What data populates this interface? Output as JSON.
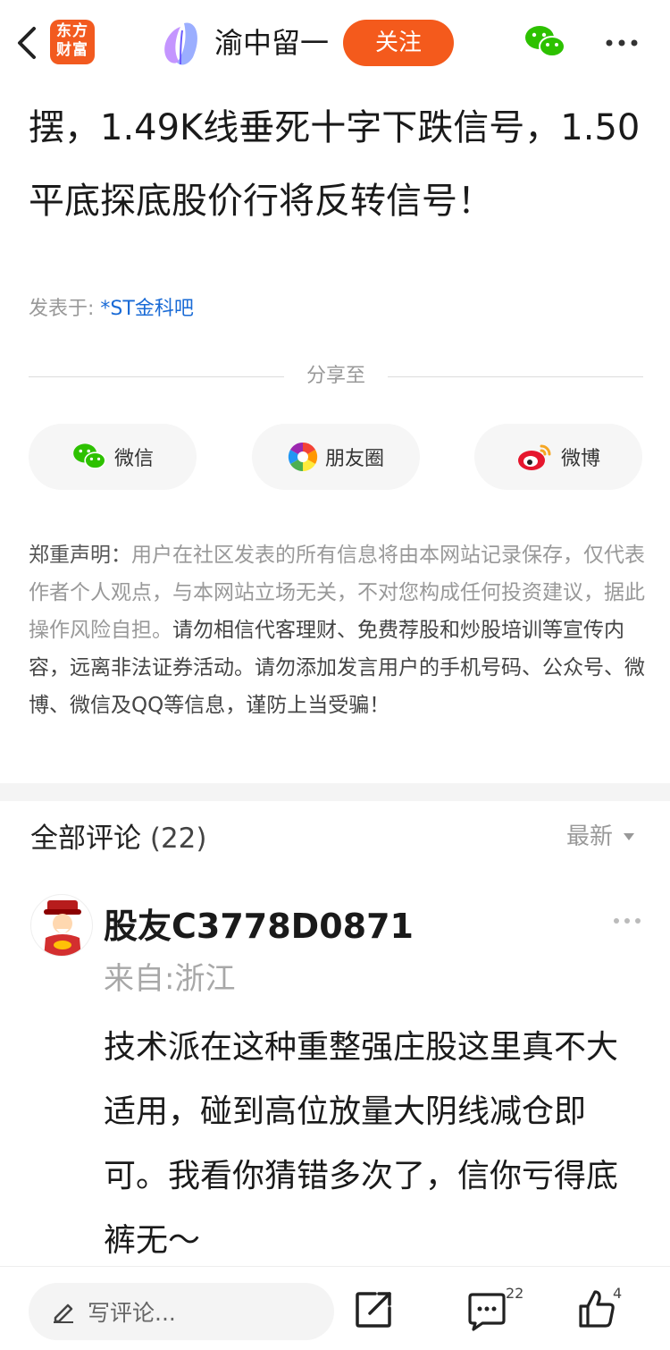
{
  "header": {
    "app_logo_line1": "东方",
    "app_logo_line2": "财富",
    "author_name": "渝中留一",
    "follow_label": "关注"
  },
  "post": {
    "title": "摆，1.49K线垂死十字下跌信号，1.50平底探底股价行将反转信号！",
    "posted_in_label": "发表于:",
    "bar_name": "*ST金科吧"
  },
  "share": {
    "label": "分享至",
    "wechat": "微信",
    "moments": "朋友圈",
    "weibo": "微博"
  },
  "disclaimer": {
    "label": "郑重声明：",
    "text_light": "用户在社区发表的所有信息将由本网站记录保存，仅代表作者个人观点，与本网站立场无关，不对您构成任何投资建议，据此操作风险自担。",
    "text_dark": "请勿相信代客理财、免费荐股和炒股培训等宣传内容，远离非法证券活动。请勿添加发言用户的手机号码、公众号、微博、微信及QQ等信息，谨防上当受骗！"
  },
  "comments": {
    "title": "全部评论",
    "count": "(22)",
    "sort_label": "最新",
    "items": [
      {
        "user": "股友C3778D0871",
        "location": "来自:浙江",
        "body": "技术派在这种重整强庄股这里真不大适用，碰到高位放量大阴线减仓即可。我看你猜错多次了，信你亏得底裤无～"
      }
    ]
  },
  "bottom_bar": {
    "write_placeholder": "写评论...",
    "comment_count": "22",
    "like_count": "4"
  },
  "colors": {
    "accent": "#f45a1c",
    "link": "#1a6bd6",
    "muted": "#999999"
  },
  "icons": [
    "back-arrow-icon",
    "app-logo",
    "author-avatar-icon",
    "wechat-icon",
    "more-icon",
    "moments-icon",
    "weibo-icon",
    "pencil-icon",
    "share-icon",
    "comment-icon",
    "like-icon"
  ]
}
